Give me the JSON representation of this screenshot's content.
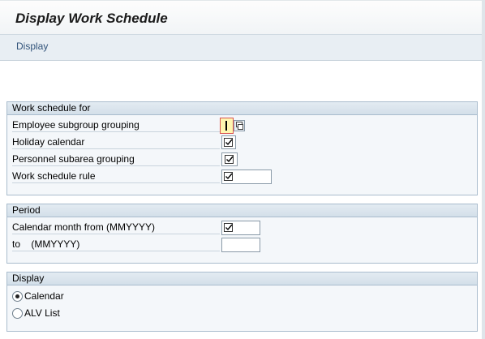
{
  "window": {
    "title": "Display Work Schedule"
  },
  "menu": {
    "items": [
      "Display"
    ]
  },
  "work_schedule_for": {
    "title": "Work schedule for",
    "rows": [
      {
        "label": "Employee subgroup grouping",
        "value": ""
      },
      {
        "label": "Holiday calendar",
        "value": ""
      },
      {
        "label": "Personnel subarea grouping",
        "value": ""
      },
      {
        "label": "Work schedule rule",
        "value": ""
      }
    ]
  },
  "period": {
    "title": "Period",
    "rows": [
      {
        "label": "Calendar month from (MMYYYY)",
        "value": ""
      },
      {
        "label": "to    (MMYYYY)",
        "value": ""
      }
    ]
  },
  "display": {
    "title": "Display",
    "options": [
      {
        "label": "Calendar",
        "selected": true
      },
      {
        "label": "ALV List",
        "selected": false
      }
    ]
  },
  "colors": {
    "accent_link": "#31537a",
    "group_border": "#a9bccd",
    "focus_border": "#d9534f"
  }
}
